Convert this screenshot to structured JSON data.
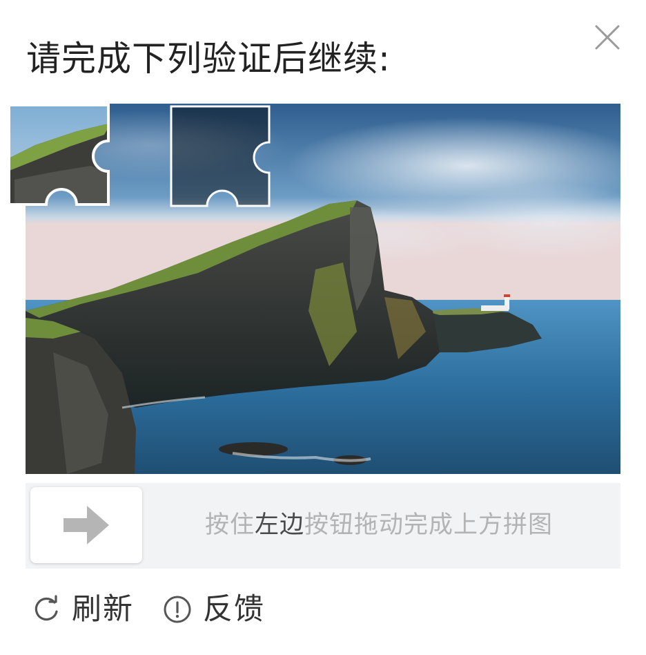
{
  "dialog": {
    "title": "请完成下列验证后继续:",
    "close_icon": "close-icon"
  },
  "captcha": {
    "image_description_icon": "coastal-cliff-lighthouse-image",
    "piece_icon": "puzzle-piece-icon",
    "gap_icon": "puzzle-gap-icon"
  },
  "slider": {
    "hint_prefix": "按住",
    "hint_emphasis": "左边",
    "hint_suffix": "按钮拖动完成上方拼图",
    "handle_icon": "arrow-right-icon",
    "progress": 0
  },
  "footer": {
    "refresh_label": "刷新",
    "refresh_icon": "refresh-icon",
    "feedback_label": "反馈",
    "feedback_icon": "info-circle-icon"
  },
  "colors": {
    "track": "#f2f3f5",
    "hint_text": "#b3b3b3",
    "hint_emphasis": "#4a4a4a",
    "title_text": "#222222"
  }
}
